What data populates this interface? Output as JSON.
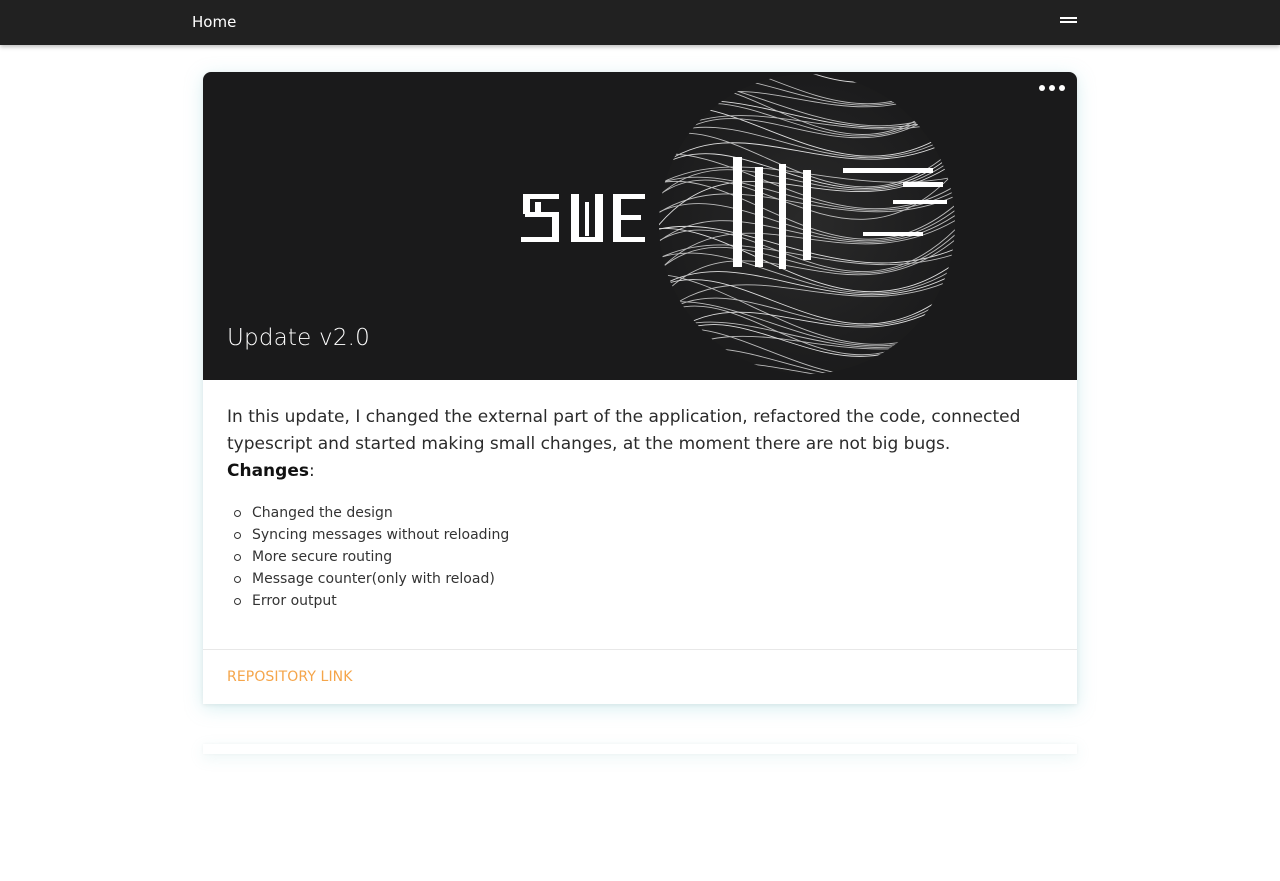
{
  "nav": {
    "home_label": "Home",
    "menu_icon": "hamburger-menu-icon"
  },
  "post": {
    "title": "Update v2.0",
    "more_icon": "more-horizontal-icon",
    "hero_image": "abstract-logo-artwork",
    "intro": "In this update, I changed the external part of the application, refactored the code, connected typescript and started making small changes, at the moment there are not big bugs.",
    "changes_label": "Changes",
    "changes_suffix": ":",
    "changes": [
      "Changed the design",
      "Syncing messages without reloading",
      "More secure routing",
      "Message counter(only with reload)",
      "Error output"
    ],
    "repo_link": "REPOSITORY LINK"
  },
  "colors": {
    "navbar": "#212121",
    "hero_bg": "#1a1a1b",
    "link": "#f5a54a",
    "card_shadow": "#8cd2d7"
  }
}
